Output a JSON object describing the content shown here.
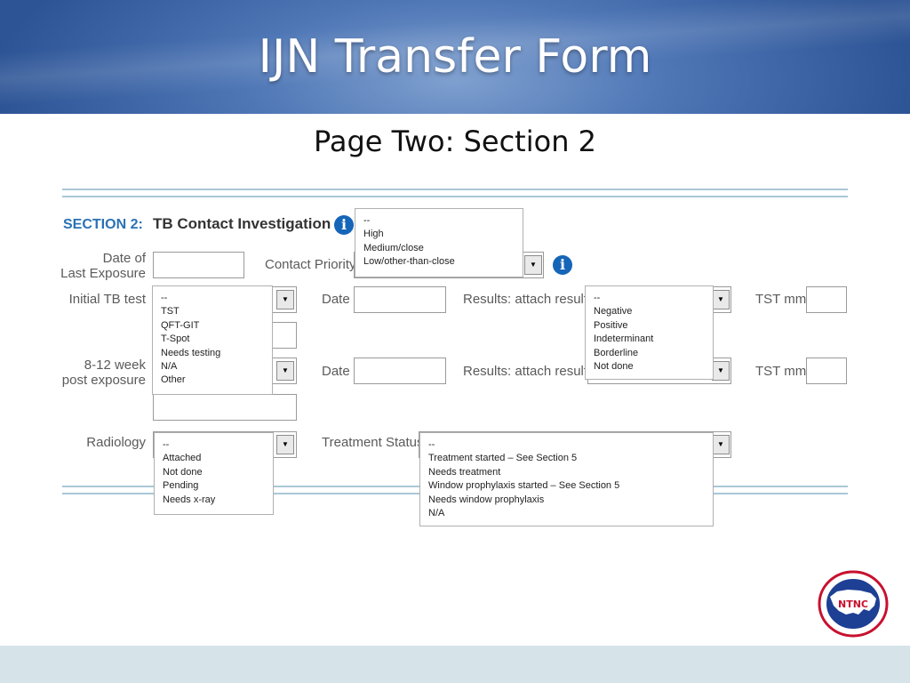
{
  "slide": {
    "title": "IJN Transfer Form",
    "subtitle": "Page Two: Section 2"
  },
  "section": {
    "number": "SECTION 2:",
    "name": "TB Contact Investigation"
  },
  "labels": {
    "date_of": "Date of",
    "last_exposure": "Last Exposure",
    "contact_priority": "Contact Priority",
    "initial_tb_test": "Initial TB test",
    "date": "Date",
    "results_attach": "Results: attach results",
    "tst_mm": "TST mm",
    "week_8_12": "8-12 week",
    "post_exposure": "post exposure",
    "radiology": "Radiology",
    "treatment_status": "Treatment Status"
  },
  "dropdowns": {
    "contact_priority": [
      "--",
      "High",
      "Medium/close",
      "Low/other-than-close"
    ],
    "test_type": [
      "--",
      "TST",
      "QFT-GIT",
      "T-Spot",
      "Needs testing",
      "N/A",
      "Other"
    ],
    "results": [
      "--",
      "Negative",
      "Positive",
      "Indeterminant",
      "Borderline",
      "Not done"
    ],
    "radiology": [
      "--",
      "Attached",
      "Not done",
      "Pending",
      "Needs x-ray"
    ],
    "treatment_status": [
      "--",
      "Treatment started – See Section 5",
      "Needs treatment",
      "Window prophylaxis started – See Section 5",
      "Needs window prophylaxis",
      "N/A"
    ]
  },
  "icons": {
    "info": "info-icon",
    "dropdown_arrow": "dropdown-arrow-icon",
    "logo": "ntnc-logo"
  },
  "logo": {
    "center_text": "NTNC"
  },
  "colors": {
    "banner": "#3d64a6",
    "section_label": "#2a72b5",
    "info_icon": "#1565b8",
    "rule": "#a9c7d6",
    "footer": "#d6e4ea"
  }
}
